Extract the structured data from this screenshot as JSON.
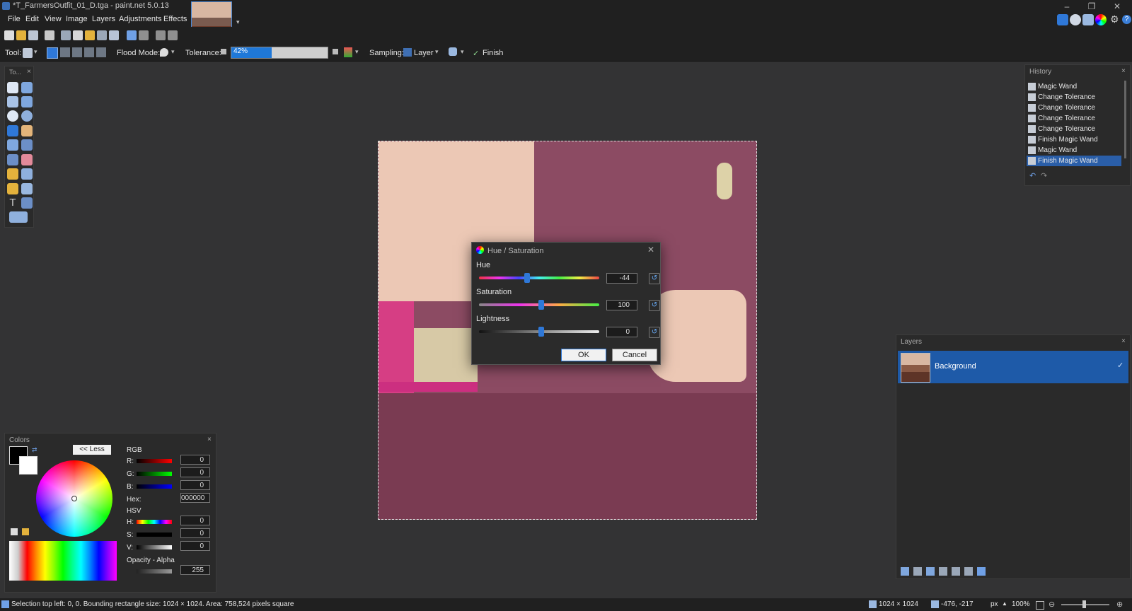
{
  "window": {
    "title": "*T_FarmersOutfit_01_D.tga - paint.net 5.0.13",
    "controls": [
      "–",
      "❐",
      "✕"
    ]
  },
  "menu": [
    "File",
    "Edit",
    "View",
    "Image",
    "Layers",
    "Adjustments",
    "Effects"
  ],
  "options": {
    "tool_label": "Tool:",
    "flood_mode_label": "Flood Mode:",
    "tolerance_label": "Tolerance:",
    "tolerance_value": "42%",
    "tolerance_fraction": 0.42,
    "sampling_label": "Sampling:",
    "sampling_value": "Layer",
    "finish_label": "Finish"
  },
  "tools_panel": {
    "title": "To...",
    "close": "×"
  },
  "dialog": {
    "title": "Hue / Saturation",
    "hue_label": "Hue",
    "hue_value": "-44",
    "saturation_label": "Saturation",
    "saturation_value": "100",
    "lightness_label": "Lightness",
    "lightness_value": "0",
    "ok": "OK",
    "cancel": "Cancel",
    "close": "✕"
  },
  "history": {
    "title": "History",
    "close": "×",
    "items": [
      "Magic Wand",
      "Change Tolerance",
      "Change Tolerance",
      "Change Tolerance",
      "Change Tolerance",
      "Finish Magic Wand",
      "Magic Wand",
      "Finish Magic Wand"
    ],
    "selected_index": 7
  },
  "layers": {
    "title": "Layers",
    "close": "×",
    "items": [
      {
        "name": "Background",
        "visible": true
      }
    ]
  },
  "colors": {
    "title": "Colors",
    "close": "×",
    "less_button": "<< Less",
    "rgb_label": "RGB",
    "r_label": "R:",
    "g_label": "G:",
    "b_label": "B:",
    "r": "0",
    "g": "0",
    "b": "0",
    "hex_label": "Hex:",
    "hex": "000000",
    "hsv_label": "HSV",
    "h_label": "H:",
    "s_label": "S:",
    "v_label": "V:",
    "h": "0",
    "s": "0",
    "v": "0",
    "opacity_label": "Opacity - Alpha",
    "alpha": "255"
  },
  "status": {
    "selection": "Selection top left: 0, 0. Bounding rectangle size: 1024 × 1024. Area: 758,524 pixels square",
    "image_size": "1024 × 1024",
    "cursor": "-476, -217",
    "units": "px",
    "zoom": "100%"
  },
  "colors_theme": {
    "accent": "#2f78d8",
    "background": "#333334",
    "panel": "#2a2a2a"
  }
}
